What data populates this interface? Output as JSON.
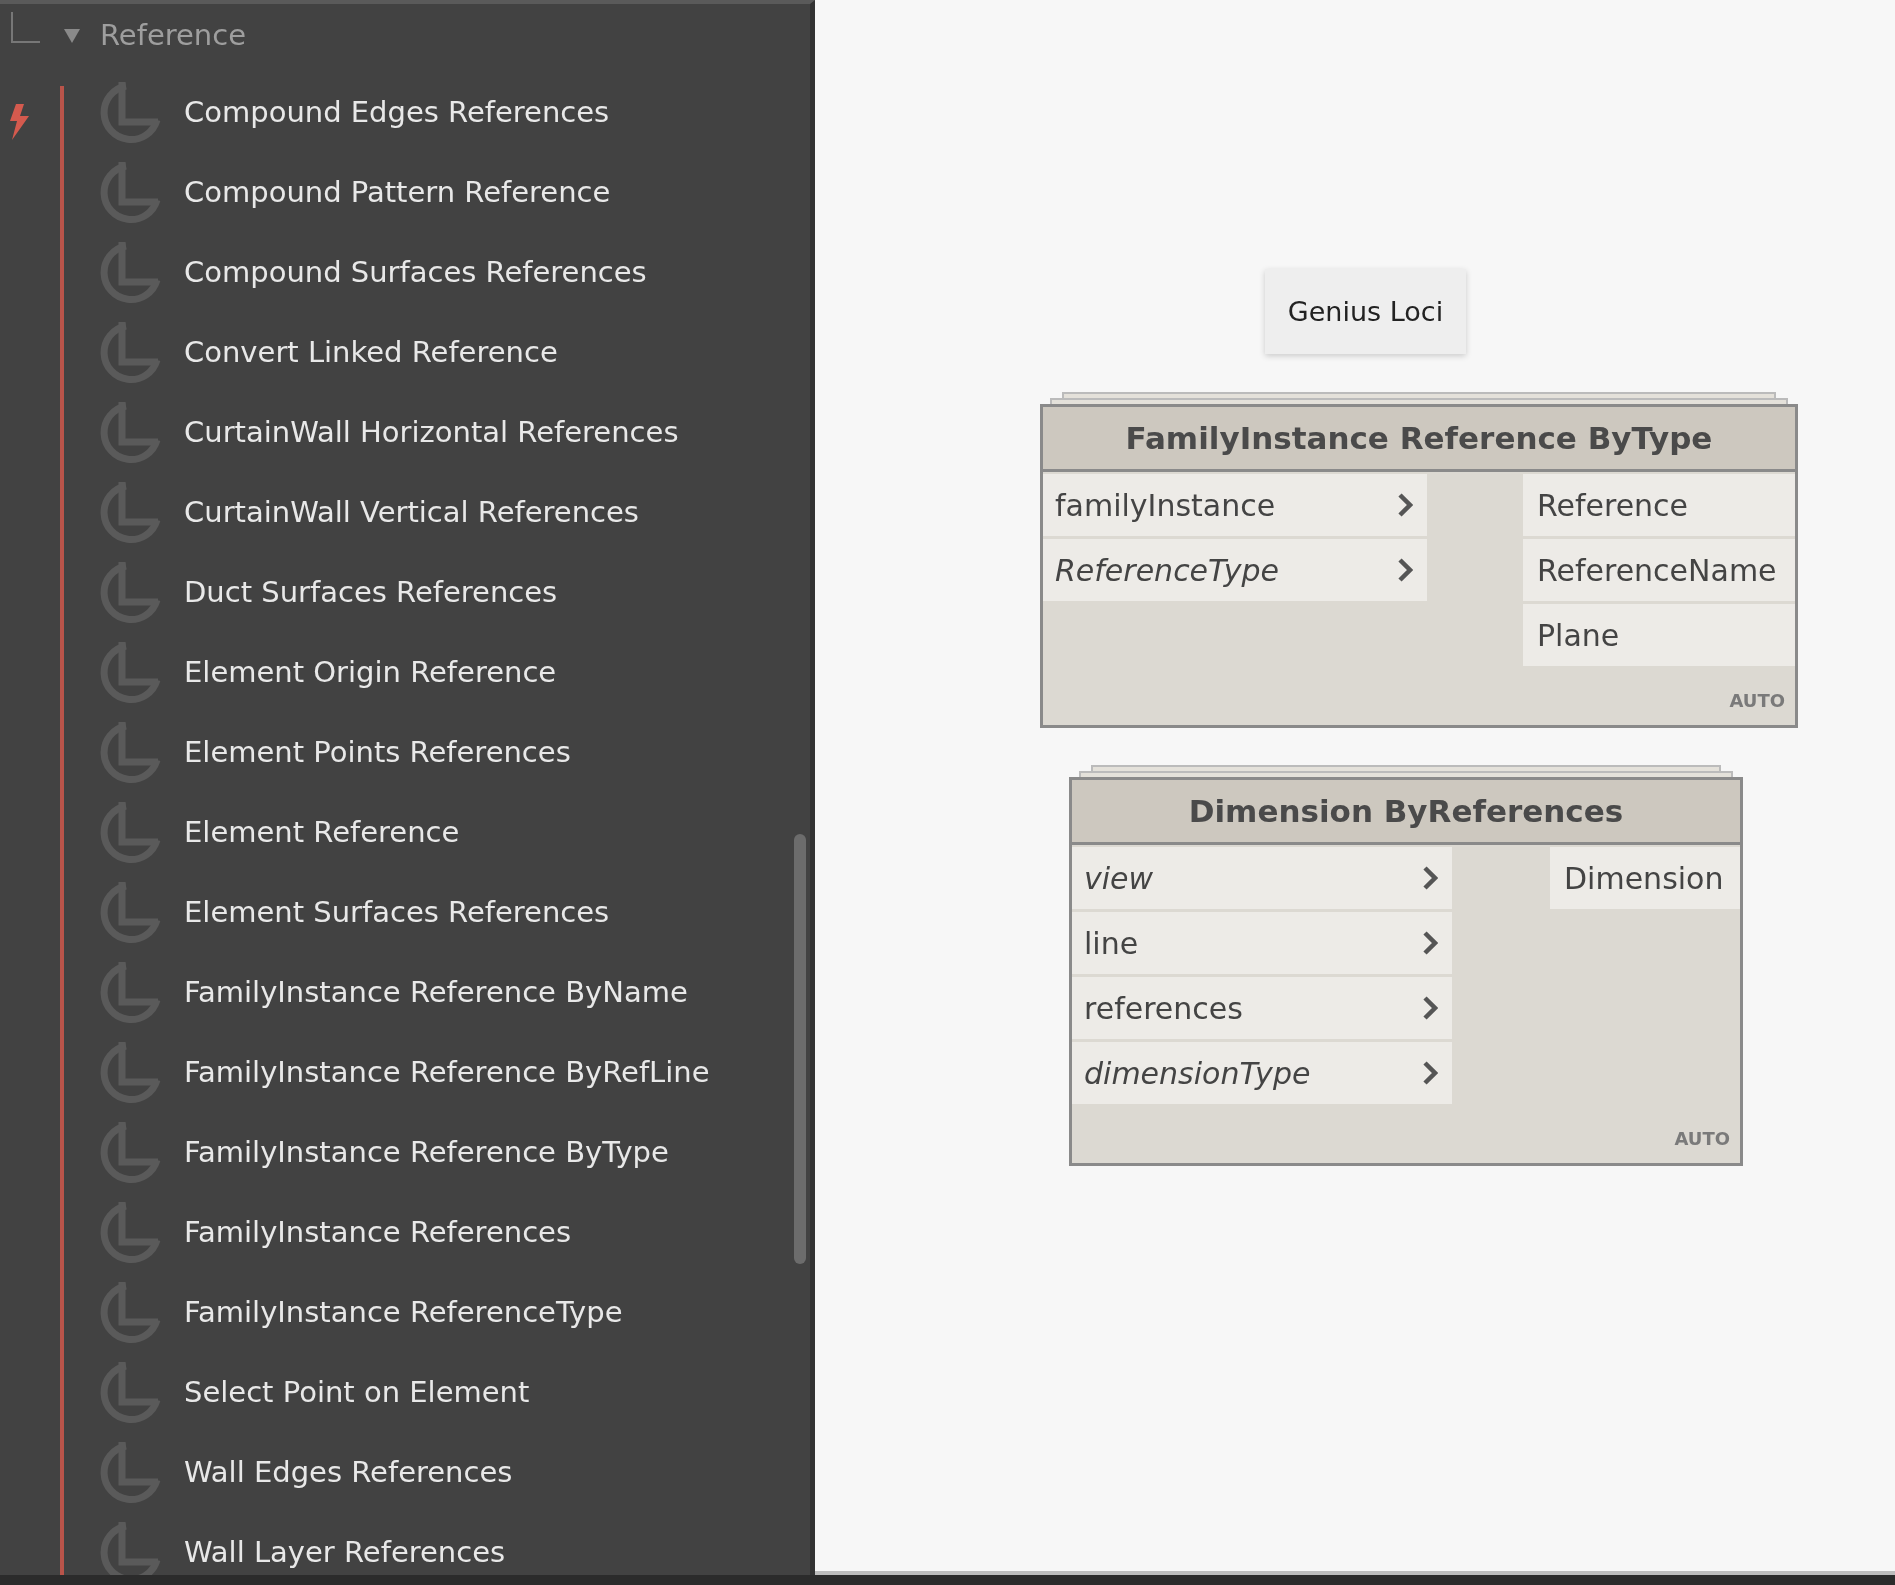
{
  "library": {
    "category": {
      "label": "Reference",
      "expanded": true
    },
    "items": [
      "Compound Edges References",
      "Compound Pattern Reference",
      "Compound Surfaces References",
      "Convert Linked Reference",
      "CurtainWall Horizontal References",
      "CurtainWall Vertical References",
      "Duct Surfaces References",
      "Element Origin Reference",
      "Element Points References",
      "Element Reference",
      "Element Surfaces References",
      "FamilyInstance Reference ByName",
      "FamilyInstance Reference ByRefLine",
      "FamilyInstance Reference ByType",
      "FamilyInstance References",
      "FamilyInstance ReferenceType",
      "Select Point on Element",
      "Wall Edges References",
      "Wall Layer References"
    ]
  },
  "canvas": {
    "group": {
      "title": "Genius Loci"
    },
    "nodes": [
      {
        "title": "FamilyInstance Reference ByType",
        "inputs": [
          {
            "name": "familyInstance",
            "optional": false
          },
          {
            "name": "ReferenceType",
            "optional": true
          }
        ],
        "outputs": [
          "Reference",
          "ReferenceName",
          "Plane"
        ],
        "lacing": "AUTO"
      },
      {
        "title": "Dimension ByReferences",
        "inputs": [
          {
            "name": "view",
            "optional": true
          },
          {
            "name": "line",
            "optional": false
          },
          {
            "name": "references",
            "optional": false
          },
          {
            "name": "dimensionType",
            "optional": true
          }
        ],
        "outputs": [
          "Dimension"
        ],
        "lacing": "AUTO"
      }
    ]
  }
}
